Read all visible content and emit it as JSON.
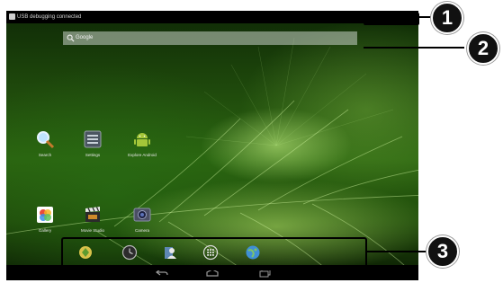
{
  "status_bar": {
    "notification_text": "USB debugging connected"
  },
  "search": {
    "placeholder": "Google"
  },
  "desktop_apps": [
    {
      "label": "Search",
      "icon": "magnifier-icon"
    },
    {
      "label": "Settings",
      "icon": "settings-icon"
    },
    {
      "label": "Explore Android",
      "icon": "android-icon"
    },
    {
      "label": "Gallery",
      "icon": "gallery-icon"
    },
    {
      "label": "Movie Studio",
      "icon": "movie-studio-icon"
    },
    {
      "label": "Camera",
      "icon": "camera-icon"
    }
  ],
  "dock": [
    "browser-icon",
    "clock-icon",
    "contacts-icon",
    "app-drawer-icon",
    "globe-icon"
  ],
  "nav_buttons": [
    "back-icon",
    "home-icon",
    "recent-apps-icon"
  ],
  "callouts": [
    {
      "number": "1"
    },
    {
      "number": "2"
    },
    {
      "number": "3"
    }
  ],
  "colors": {
    "wallpaper": "#2b6410",
    "status_bar": "#000000",
    "callout_badge": "#111111"
  }
}
